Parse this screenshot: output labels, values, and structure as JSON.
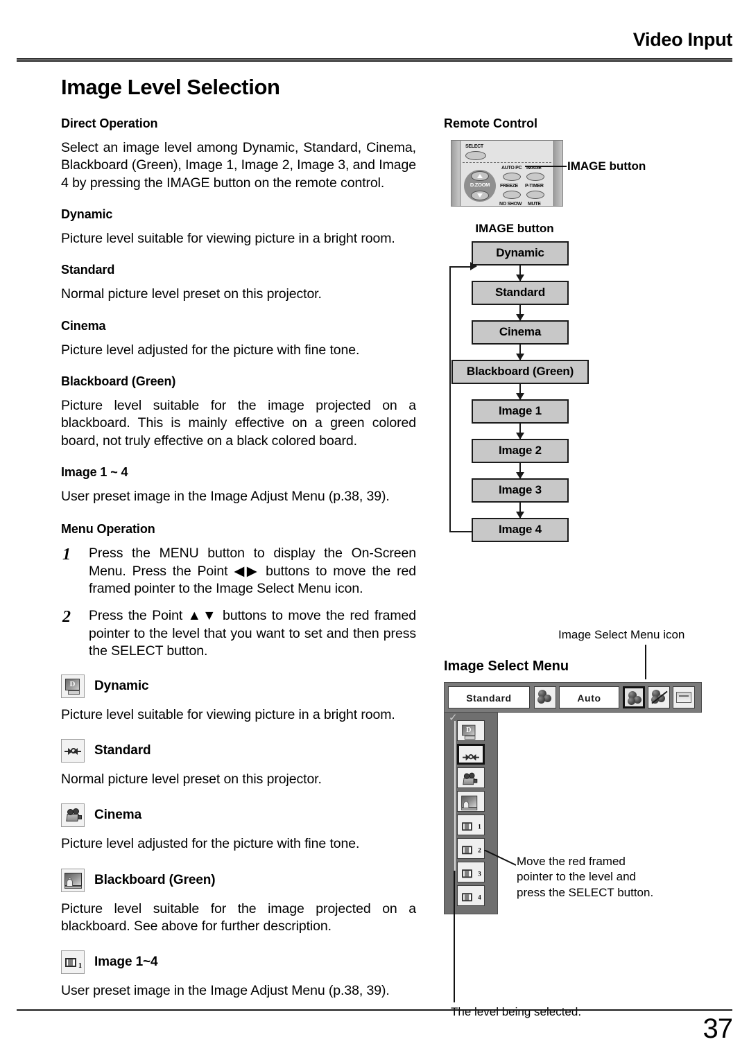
{
  "header": {
    "running_head": "Video Input"
  },
  "page": {
    "title": "Image Level Selection",
    "number": "37"
  },
  "direct_operation": {
    "heading": "Direct Operation",
    "intro": "Select an image level among Dynamic, Standard, Cinema, Blackboard (Green), Image 1, Image 2, Image 3, and Image 4 by pressing the IMAGE button on the remote control.",
    "levels": [
      {
        "name": "Dynamic",
        "description": "Picture level suitable for viewing picture in a bright room."
      },
      {
        "name": "Standard",
        "description": "Normal picture level preset on this projector."
      },
      {
        "name": "Cinema",
        "description": "Picture level adjusted for the picture with fine tone."
      },
      {
        "name": "Blackboard (Green)",
        "description": "Picture level suitable for the image projected on a blackboard.  This is mainly effective on a green colored board, not truly effective on a black colored board."
      },
      {
        "name": "Image 1 ~ 4",
        "description": "User preset image in the Image Adjust Menu (p.38, 39)."
      }
    ]
  },
  "menu_operation": {
    "heading": "Menu Operation",
    "steps": [
      {
        "number": "1",
        "text": "Press the MENU button to display the On-Screen Menu.  Press the Point ◀▶ buttons to move the red framed pointer to the Image Select Menu icon."
      },
      {
        "number": "2",
        "text": "Press the Point ▲▼ buttons to move the red framed pointer to the level that you want to set and then press the SELECT button."
      }
    ],
    "levels": [
      {
        "icon": "dynamic-monitor-icon",
        "name": "Dynamic",
        "description": "Picture level suitable for viewing picture in a bright room."
      },
      {
        "icon": "standard-arrows-icon",
        "name": "Standard",
        "description": "Normal picture level preset on this projector."
      },
      {
        "icon": "cinema-camera-icon",
        "name": "Cinema",
        "description": "Picture level adjusted for the picture with fine tone."
      },
      {
        "icon": "blackboard-icon",
        "name": "Blackboard (Green)",
        "description": "Picture level suitable for the image projected on a blackboard. See above for further description."
      },
      {
        "icon": "image-number-icon",
        "name": "Image 1~4",
        "description": "User preset image in the Image Adjust Menu (p.38, 39)."
      }
    ]
  },
  "remote_control": {
    "heading": "Remote Control",
    "callout": "IMAGE button",
    "buttons": [
      "SELECT",
      "AUTO PC",
      "IMAGE",
      "FREEZE",
      "P-TIMER",
      "D.ZOOM",
      "NO SHOW",
      "MUTE"
    ],
    "labels": {
      "select": "SELECT",
      "autopc": "AUTO PC",
      "image": "IMAGE",
      "freeze": "FREEZE",
      "ptimer": "P-TIMER",
      "dzoom": "D.ZOOM",
      "noshow": "NO SHOW",
      "mute": "MUTE"
    }
  },
  "flowchart": {
    "title": "IMAGE button",
    "nodes": [
      "Dynamic",
      "Standard",
      "Cinema",
      "Blackboard (Green)",
      "Image 1",
      "Image 2",
      "Image 3",
      "Image 4"
    ]
  },
  "image_select_menu": {
    "heading": "Image Select Menu",
    "icon_callout": "Image Select Menu icon",
    "pointer_callout": "Move the red framed pointer to the level and press the SELECT button.",
    "level_caption": "The level being selected.",
    "osd": {
      "level_field": "Standard",
      "auto_field": "Auto",
      "top_icons": [
        "image-select-menu-icon",
        "image-adjust-menu-icon",
        "screen-menu-icon"
      ],
      "list_icons": [
        "dynamic-monitor-icon",
        "standard-arrows-icon",
        "cinema-camera-icon",
        "blackboard-icon",
        "image-1-icon",
        "image-2-icon",
        "image-3-icon",
        "image-4-icon"
      ],
      "selected_index": 1,
      "image_icon_numbers": [
        "1",
        "2",
        "3",
        "4"
      ]
    }
  },
  "colors": {
    "flow_node_fill": "#c8c8c8",
    "osd_bar": "#7a7a7a",
    "osd_body": "#6f6f6f",
    "rule": "#1a1a1a"
  }
}
